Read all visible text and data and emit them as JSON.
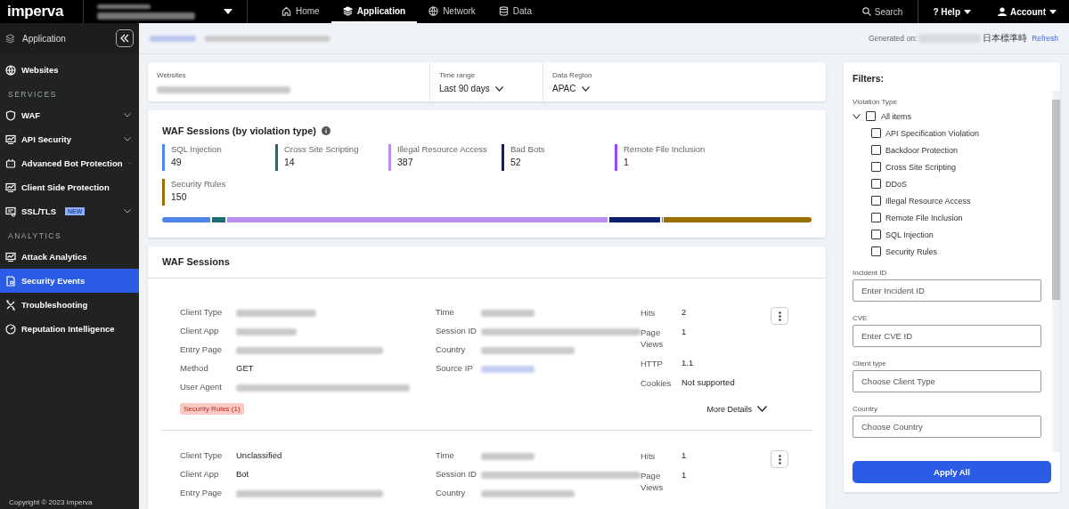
{
  "topbar": {
    "logo": "imperva",
    "nav": [
      {
        "label": "Home",
        "selected": false
      },
      {
        "label": "Application",
        "selected": true
      },
      {
        "label": "Network",
        "selected": false
      },
      {
        "label": "Data",
        "selected": false
      }
    ],
    "search": "Search",
    "help_icon": "?",
    "help": "Help",
    "account": "Account"
  },
  "sidebar": {
    "header": "Application",
    "items": [
      {
        "kind": "item",
        "label": "Websites",
        "selected": false,
        "expandable": false
      },
      {
        "kind": "section",
        "label": "SERVICES"
      },
      {
        "kind": "item",
        "label": "WAF",
        "selected": false,
        "expandable": true
      },
      {
        "kind": "item",
        "label": "API Security",
        "selected": false,
        "expandable": true
      },
      {
        "kind": "item",
        "label": "Advanced Bot Protection",
        "selected": false,
        "expandable": true
      },
      {
        "kind": "item",
        "label": "Client Side Protection",
        "selected": false,
        "expandable": false
      },
      {
        "kind": "item",
        "label": "SSL/TLS",
        "badge": "NEW",
        "selected": false,
        "expandable": true
      },
      {
        "kind": "section",
        "label": "ANALYTICS"
      },
      {
        "kind": "item",
        "label": "Attack Analytics",
        "selected": false,
        "expandable": false
      },
      {
        "kind": "item",
        "label": "Security Events",
        "selected": true,
        "expandable": false
      },
      {
        "kind": "item",
        "label": "Troubleshooting",
        "selected": false,
        "expandable": false
      },
      {
        "kind": "item",
        "label": "Reputation Intelligence",
        "selected": false,
        "expandable": false
      }
    ],
    "copyright": "Copyright © 2023 Imperva"
  },
  "header": {
    "generated_label": "Generated on:",
    "timezone": "日本標準時",
    "refresh": "Refresh"
  },
  "selectors": [
    {
      "label": "Websites",
      "kind": "redacted"
    },
    {
      "label": "Time range",
      "kind": "text",
      "value": "Last 90 days"
    },
    {
      "label": "Data Region",
      "kind": "text",
      "value": "APAC"
    }
  ],
  "violations": {
    "title": "WAF Sessions (by violation type)",
    "items": [
      {
        "name": "SQL Injection",
        "count": "49",
        "color": "#4f86ec"
      },
      {
        "name": "Cross Site Scripting",
        "count": "14",
        "color": "#1f6b75"
      },
      {
        "name": "Illegal Resource Access",
        "count": "387",
        "color": "#b98ef0"
      },
      {
        "name": "Bad Bots",
        "count": "52",
        "color": "#0c1f6b"
      },
      {
        "name": "Remote File Inclusion",
        "count": "1",
        "color": "#9747ff"
      },
      {
        "name": "Security Rules",
        "count": "150",
        "color": "#9a6f00"
      }
    ]
  },
  "sessions": {
    "title": "WAF Sessions",
    "cards": [
      {
        "columns": [
          [
            {
              "label": "Client Type",
              "kind": "redacted"
            },
            {
              "label": "Client App",
              "kind": "redacted"
            },
            {
              "label": "Entry Page",
              "kind": "redacted"
            },
            {
              "label": "Method",
              "kind": "text",
              "value": "GET"
            },
            {
              "label": "User Agent",
              "kind": "redacted"
            }
          ],
          [
            {
              "label": "Time",
              "kind": "redacted"
            },
            {
              "label": "Session ID",
              "kind": "redacted"
            },
            {
              "label": "Country",
              "kind": "redacted"
            },
            {
              "label": "Source IP",
              "kind": "link_redacted"
            }
          ],
          [
            {
              "label": "Hits",
              "kind": "text",
              "value": "2"
            },
            {
              "label": "Page Views",
              "kind": "text",
              "value": "1"
            },
            {
              "label": "HTTP",
              "kind": "text",
              "value": "1.1"
            },
            {
              "label": "Cookies",
              "kind": "text",
              "value": "Not supported"
            }
          ]
        ],
        "tag": "Security Rules (1)",
        "more": "More Details"
      },
      {
        "columns": [
          [
            {
              "label": "Client Type",
              "kind": "text",
              "value": "Unclassified"
            },
            {
              "label": "Client App",
              "kind": "text",
              "value": "Bot"
            },
            {
              "label": "Entry Page",
              "kind": "redacted"
            }
          ],
          [
            {
              "label": "Time",
              "kind": "redacted"
            },
            {
              "label": "Session ID",
              "kind": "redacted"
            },
            {
              "label": "Country",
              "kind": "redacted"
            }
          ],
          [
            {
              "label": "Hits",
              "kind": "text",
              "value": "1"
            },
            {
              "label": "Page Views",
              "kind": "text",
              "value": "1"
            }
          ]
        ]
      }
    ]
  },
  "filters": {
    "title": "Filters:",
    "violation_label": "Violation Type",
    "all": {
      "label": "All items",
      "checked": false,
      "expanded": true
    },
    "options": [
      {
        "label": "API Specification Violation",
        "checked": false
      },
      {
        "label": "Backdoor Protection",
        "checked": false
      },
      {
        "label": "Cross Site Scripting",
        "checked": false
      },
      {
        "label": "DDoS",
        "checked": false
      },
      {
        "label": "Illegal Resource Access",
        "checked": false
      },
      {
        "label": "Remote File Inclusion",
        "checked": false
      },
      {
        "label": "SQL Injection",
        "checked": false
      },
      {
        "label": "Security Rules",
        "checked": false
      }
    ],
    "fields": [
      {
        "label": "Incident ID",
        "placeholder": "Enter Incident ID"
      },
      {
        "label": "CVE",
        "placeholder": "Enter CVE ID"
      },
      {
        "label": "Client type",
        "placeholder": "Choose Client Type"
      },
      {
        "label": "Country",
        "placeholder": "Choose Country"
      }
    ],
    "apply": "Apply All"
  }
}
